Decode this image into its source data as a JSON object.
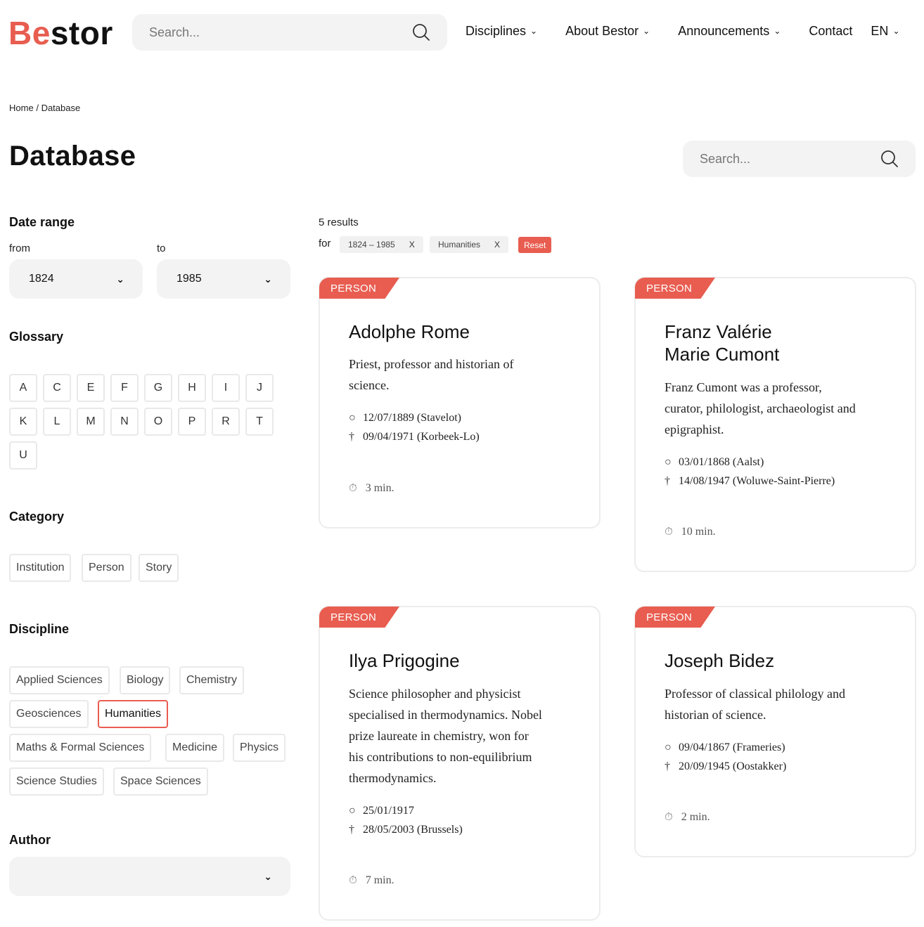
{
  "header": {
    "logo_accent": "Be",
    "logo_rest": "stor",
    "search_placeholder": "Search...",
    "nav": [
      {
        "label": "Disciplines",
        "dropdown": true
      },
      {
        "label": "About Bestor",
        "dropdown": true
      },
      {
        "label": "Announcements",
        "dropdown": true
      },
      {
        "label": "Contact",
        "dropdown": false
      },
      {
        "label": "EN",
        "dropdown": true
      }
    ]
  },
  "breadcrumb": {
    "home": "Home",
    "separator": "/",
    "current": "Database"
  },
  "page": {
    "title": "Database",
    "search_placeholder": "Search..."
  },
  "sidebar": {
    "date_range": {
      "title": "Date range",
      "from_label": "from",
      "to_label": "to",
      "from_value": "1824",
      "to_value": "1985"
    },
    "glossary": {
      "title": "Glossary",
      "letters": [
        "A",
        "C",
        "E",
        "F",
        "G",
        "H",
        "I",
        "J",
        "K",
        "L",
        "M",
        "N",
        "O",
        "P",
        "R",
        "T",
        "U"
      ]
    },
    "category": {
      "title": "Category",
      "items": [
        "Institution",
        "Person",
        "Story"
      ]
    },
    "discipline": {
      "title": "Discipline",
      "items": [
        "Applied Sciences",
        "Biology",
        "Chemistry",
        "Geosciences",
        "Humanities",
        "Maths & Formal Sciences",
        "Medicine",
        "Physics",
        "Science Studies",
        "Space Sciences"
      ],
      "active": "Humanities"
    },
    "author": {
      "title": "Author",
      "value": ""
    }
  },
  "results": {
    "count_text": "5 results",
    "for_label": "for",
    "filters": [
      {
        "label": "1824 – 1985",
        "remove": "X"
      },
      {
        "label": "Humanities",
        "remove": "X"
      }
    ],
    "reset_label": "Reset"
  },
  "cards": [
    {
      "type": "PERSON",
      "title_lines": [
        "Adolphe Rome"
      ],
      "desc_lines": [
        "Priest, professor and historian of",
        "science."
      ],
      "born": "12/07/1889 (Stavelot)",
      "died": "09/04/1971 (Korbeek-Lo)",
      "read_time": "3 min."
    },
    {
      "type": "PERSON",
      "title_lines": [
        "Franz Valérie",
        "Marie Cumont"
      ],
      "desc_lines": [
        "Franz Cumont was a professor,",
        "curator, philologist, archaeologist and",
        "epigraphist."
      ],
      "born": "03/01/1868 (Aalst)",
      "died": "14/08/1947 (Woluwe-Saint-Pierre)",
      "read_time": "10 min."
    },
    {
      "type": "PERSON",
      "title_lines": [
        "Ilya Prigogine"
      ],
      "desc_lines": [
        "Science philosopher and physicist",
        "specialised in thermodynamics. Nobel",
        "prize laureate in chemistry, won for",
        "his contributions to non-equilibrium",
        "thermodynamics."
      ],
      "born": "25/01/1917",
      "died": "28/05/2003 (Brussels)",
      "read_time": "7 min."
    },
    {
      "type": "PERSON",
      "title_lines": [
        "Joseph Bidez"
      ],
      "desc_lines": [
        "Professor of classical philology and",
        "historian of science."
      ],
      "born": "09/04/1867 (Frameries)",
      "died": "20/09/1945 (Oostakker)",
      "read_time": "2 min."
    }
  ],
  "colors": {
    "accent": "#e85d50",
    "field_bg": "#f3f3f3",
    "border": "#e9e9e9"
  },
  "icons": {
    "born": "○",
    "died": "†",
    "read_time": "stopwatch-icon",
    "search": "search-icon"
  }
}
